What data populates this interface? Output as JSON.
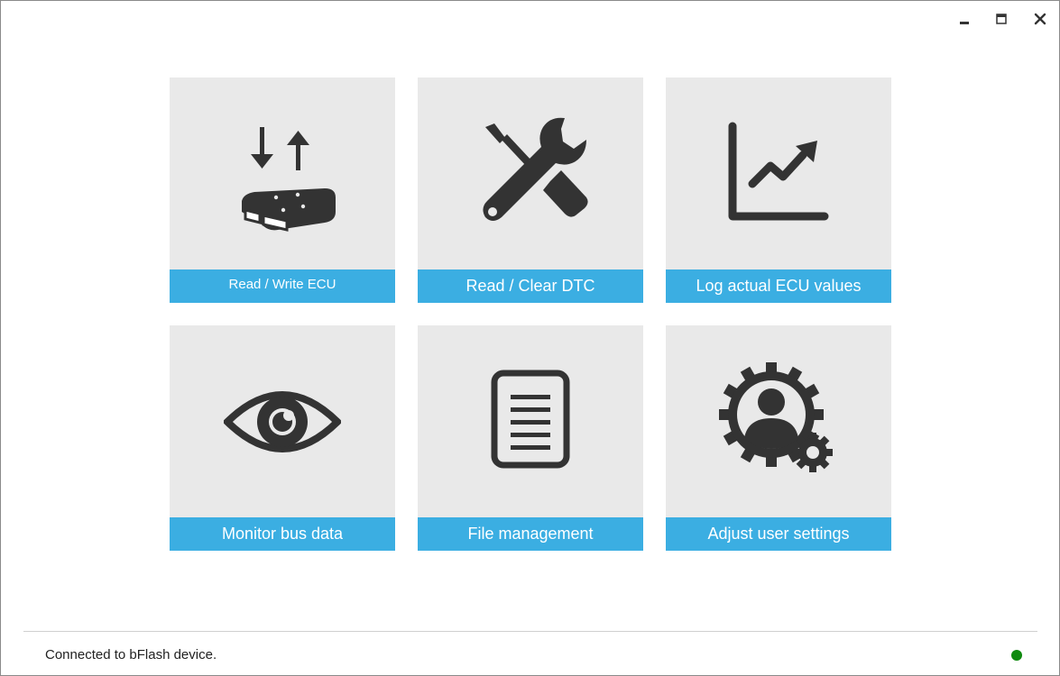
{
  "colors": {
    "tile_bg": "#e9e9e9",
    "label_bg": "#3baee2",
    "icon": "#333333",
    "status_ok": "#0f8a0f"
  },
  "window_controls": [
    {
      "icon": "minimize-icon"
    },
    {
      "icon": "maximize-icon"
    },
    {
      "icon": "close-icon"
    }
  ],
  "tiles": [
    {
      "label": "Read / Write ECU",
      "icon": "ecu-read-write-icon"
    },
    {
      "label": "Read / Clear DTC",
      "icon": "tools-icon"
    },
    {
      "label": "Log actual ECU values",
      "icon": "chart-trend-icon"
    },
    {
      "label": "Monitor bus data",
      "icon": "eye-icon"
    },
    {
      "label": "File management",
      "icon": "document-icon"
    },
    {
      "label": "Adjust user settings",
      "icon": "user-gear-icon"
    }
  ],
  "status": {
    "text": "Connected to bFlash device.",
    "indicator": "connected"
  }
}
